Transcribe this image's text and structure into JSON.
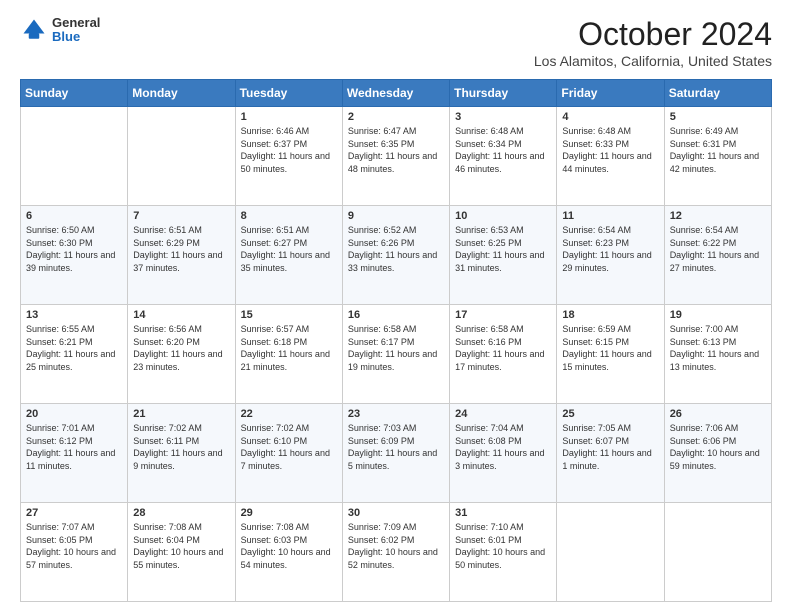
{
  "header": {
    "logo": {
      "line1": "General",
      "line2": "Blue"
    },
    "title": "October 2024",
    "subtitle": "Los Alamitos, California, United States"
  },
  "weekdays": [
    "Sunday",
    "Monday",
    "Tuesday",
    "Wednesday",
    "Thursday",
    "Friday",
    "Saturday"
  ],
  "weeks": [
    [
      {
        "day": "",
        "detail": ""
      },
      {
        "day": "",
        "detail": ""
      },
      {
        "day": "1",
        "detail": "Sunrise: 6:46 AM\nSunset: 6:37 PM\nDaylight: 11 hours and 50 minutes."
      },
      {
        "day": "2",
        "detail": "Sunrise: 6:47 AM\nSunset: 6:35 PM\nDaylight: 11 hours and 48 minutes."
      },
      {
        "day": "3",
        "detail": "Sunrise: 6:48 AM\nSunset: 6:34 PM\nDaylight: 11 hours and 46 minutes."
      },
      {
        "day": "4",
        "detail": "Sunrise: 6:48 AM\nSunset: 6:33 PM\nDaylight: 11 hours and 44 minutes."
      },
      {
        "day": "5",
        "detail": "Sunrise: 6:49 AM\nSunset: 6:31 PM\nDaylight: 11 hours and 42 minutes."
      }
    ],
    [
      {
        "day": "6",
        "detail": "Sunrise: 6:50 AM\nSunset: 6:30 PM\nDaylight: 11 hours and 39 minutes."
      },
      {
        "day": "7",
        "detail": "Sunrise: 6:51 AM\nSunset: 6:29 PM\nDaylight: 11 hours and 37 minutes."
      },
      {
        "day": "8",
        "detail": "Sunrise: 6:51 AM\nSunset: 6:27 PM\nDaylight: 11 hours and 35 minutes."
      },
      {
        "day": "9",
        "detail": "Sunrise: 6:52 AM\nSunset: 6:26 PM\nDaylight: 11 hours and 33 minutes."
      },
      {
        "day": "10",
        "detail": "Sunrise: 6:53 AM\nSunset: 6:25 PM\nDaylight: 11 hours and 31 minutes."
      },
      {
        "day": "11",
        "detail": "Sunrise: 6:54 AM\nSunset: 6:23 PM\nDaylight: 11 hours and 29 minutes."
      },
      {
        "day": "12",
        "detail": "Sunrise: 6:54 AM\nSunset: 6:22 PM\nDaylight: 11 hours and 27 minutes."
      }
    ],
    [
      {
        "day": "13",
        "detail": "Sunrise: 6:55 AM\nSunset: 6:21 PM\nDaylight: 11 hours and 25 minutes."
      },
      {
        "day": "14",
        "detail": "Sunrise: 6:56 AM\nSunset: 6:20 PM\nDaylight: 11 hours and 23 minutes."
      },
      {
        "day": "15",
        "detail": "Sunrise: 6:57 AM\nSunset: 6:18 PM\nDaylight: 11 hours and 21 minutes."
      },
      {
        "day": "16",
        "detail": "Sunrise: 6:58 AM\nSunset: 6:17 PM\nDaylight: 11 hours and 19 minutes."
      },
      {
        "day": "17",
        "detail": "Sunrise: 6:58 AM\nSunset: 6:16 PM\nDaylight: 11 hours and 17 minutes."
      },
      {
        "day": "18",
        "detail": "Sunrise: 6:59 AM\nSunset: 6:15 PM\nDaylight: 11 hours and 15 minutes."
      },
      {
        "day": "19",
        "detail": "Sunrise: 7:00 AM\nSunset: 6:13 PM\nDaylight: 11 hours and 13 minutes."
      }
    ],
    [
      {
        "day": "20",
        "detail": "Sunrise: 7:01 AM\nSunset: 6:12 PM\nDaylight: 11 hours and 11 minutes."
      },
      {
        "day": "21",
        "detail": "Sunrise: 7:02 AM\nSunset: 6:11 PM\nDaylight: 11 hours and 9 minutes."
      },
      {
        "day": "22",
        "detail": "Sunrise: 7:02 AM\nSunset: 6:10 PM\nDaylight: 11 hours and 7 minutes."
      },
      {
        "day": "23",
        "detail": "Sunrise: 7:03 AM\nSunset: 6:09 PM\nDaylight: 11 hours and 5 minutes."
      },
      {
        "day": "24",
        "detail": "Sunrise: 7:04 AM\nSunset: 6:08 PM\nDaylight: 11 hours and 3 minutes."
      },
      {
        "day": "25",
        "detail": "Sunrise: 7:05 AM\nSunset: 6:07 PM\nDaylight: 11 hours and 1 minute."
      },
      {
        "day": "26",
        "detail": "Sunrise: 7:06 AM\nSunset: 6:06 PM\nDaylight: 10 hours and 59 minutes."
      }
    ],
    [
      {
        "day": "27",
        "detail": "Sunrise: 7:07 AM\nSunset: 6:05 PM\nDaylight: 10 hours and 57 minutes."
      },
      {
        "day": "28",
        "detail": "Sunrise: 7:08 AM\nSunset: 6:04 PM\nDaylight: 10 hours and 55 minutes."
      },
      {
        "day": "29",
        "detail": "Sunrise: 7:08 AM\nSunset: 6:03 PM\nDaylight: 10 hours and 54 minutes."
      },
      {
        "day": "30",
        "detail": "Sunrise: 7:09 AM\nSunset: 6:02 PM\nDaylight: 10 hours and 52 minutes."
      },
      {
        "day": "31",
        "detail": "Sunrise: 7:10 AM\nSunset: 6:01 PM\nDaylight: 10 hours and 50 minutes."
      },
      {
        "day": "",
        "detail": ""
      },
      {
        "day": "",
        "detail": ""
      }
    ]
  ]
}
